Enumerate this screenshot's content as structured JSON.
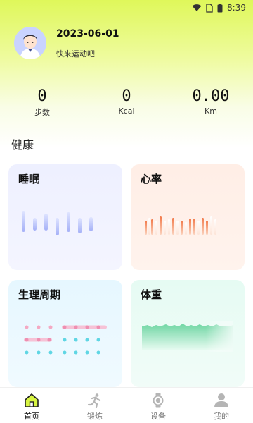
{
  "status_bar": {
    "time": "8:39"
  },
  "profile": {
    "date": "2023-06-01",
    "slogan": "快来运动吧"
  },
  "stats": [
    {
      "value": "0",
      "label": "步数"
    },
    {
      "value": "0",
      "label": "Kcal"
    },
    {
      "value": "0.00",
      "label": "Km"
    }
  ],
  "section": {
    "title": "健康"
  },
  "cards": {
    "sleep": {
      "title": "睡眠"
    },
    "heart": {
      "title": "心率"
    },
    "period": {
      "title": "生理周期"
    },
    "weight": {
      "title": "体重"
    }
  },
  "nav": {
    "items": [
      {
        "label": "首页",
        "icon": "home-icon",
        "active": true
      },
      {
        "label": "锻炼",
        "icon": "running-icon",
        "active": false
      },
      {
        "label": "设备",
        "icon": "watch-icon",
        "active": false
      },
      {
        "label": "我的",
        "icon": "person-icon",
        "active": false
      }
    ]
  },
  "colors": {
    "accent": "#d8f542",
    "sleep_bar": "#aab6ff",
    "heart_bar": "#f08a5d",
    "period_pink": "#f4a7c0",
    "period_cyan": "#5fd8e6",
    "weight_fill": "#7fdcaf"
  }
}
